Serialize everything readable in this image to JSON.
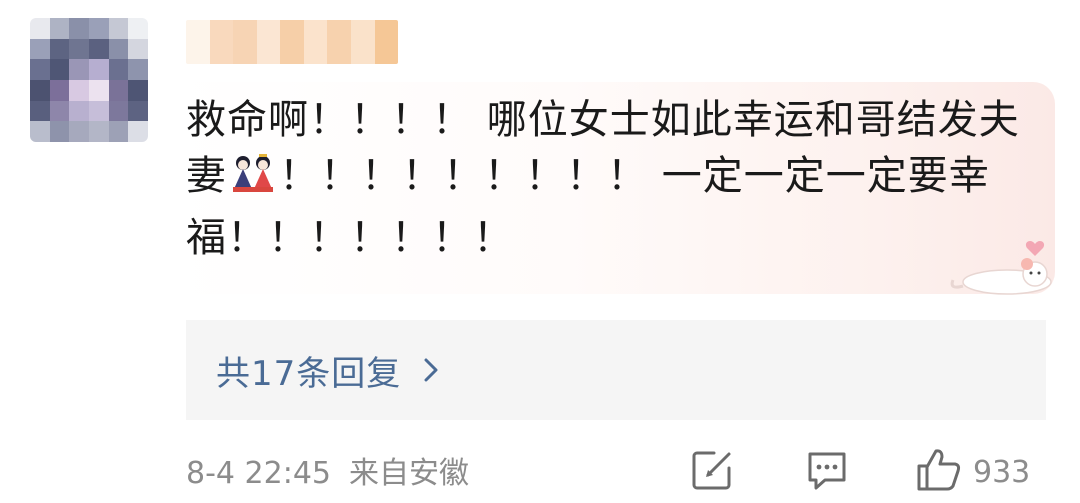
{
  "user": {
    "avatar": "avatar-image",
    "name_redacted": true
  },
  "comment": {
    "text_part1": "救命啊！！！！  哪位女士如此幸运和哥结发夫妻",
    "emoji": "dolls-emoji",
    "text_part2": "！！！！！！！！！  一定一定一定要幸福！！！！！！！"
  },
  "replies": {
    "label": "共17条回复",
    "icon": "chevron-right-icon"
  },
  "meta": {
    "timestamp": "8-4 22:45",
    "location": "来自安徽"
  },
  "actions": {
    "share_icon": "share-icon",
    "comment_icon": "comment-icon",
    "like_icon": "thumbs-up-icon",
    "like_count": "933"
  },
  "colors": {
    "reply_link": "#4a6b95",
    "meta_text": "#8c8c8c",
    "reply_bg": "#f5f5f5"
  }
}
